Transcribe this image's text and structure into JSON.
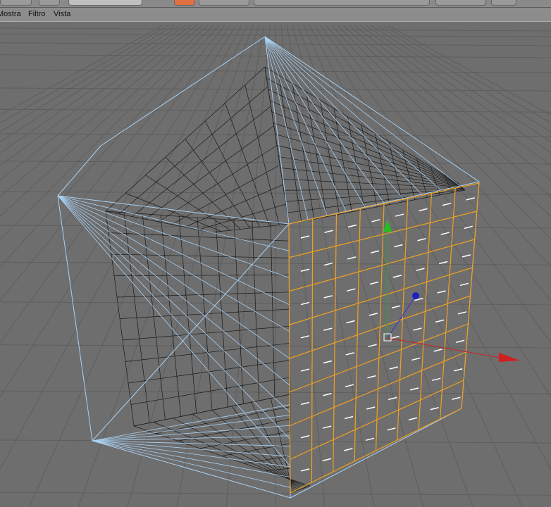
{
  "menu": {
    "items": [
      "Mostra",
      "Filtro",
      "Vista"
    ]
  },
  "colors": {
    "viewport_bg": "#6e6e6e",
    "cage": "#a9d2f5",
    "mesh": "#1a1a1a",
    "selection": "#f0a020",
    "axis_x": "#d02020",
    "axis_y": "#20b020",
    "axis_z": "#2020d0"
  },
  "toolbar": {
    "icons": [
      "undo-icon",
      "move-icon",
      "sphere-icon",
      "sphere-icon",
      "sphere-icon",
      "render-icon",
      "cube-icon",
      "cube-icon",
      "camera-icon",
      "arrow-icon",
      "add-icon",
      "light-icon",
      "spline-icon",
      "deform-icon",
      "scene-icon",
      "camera-icon",
      "layout-icon",
      "window-icon"
    ]
  }
}
